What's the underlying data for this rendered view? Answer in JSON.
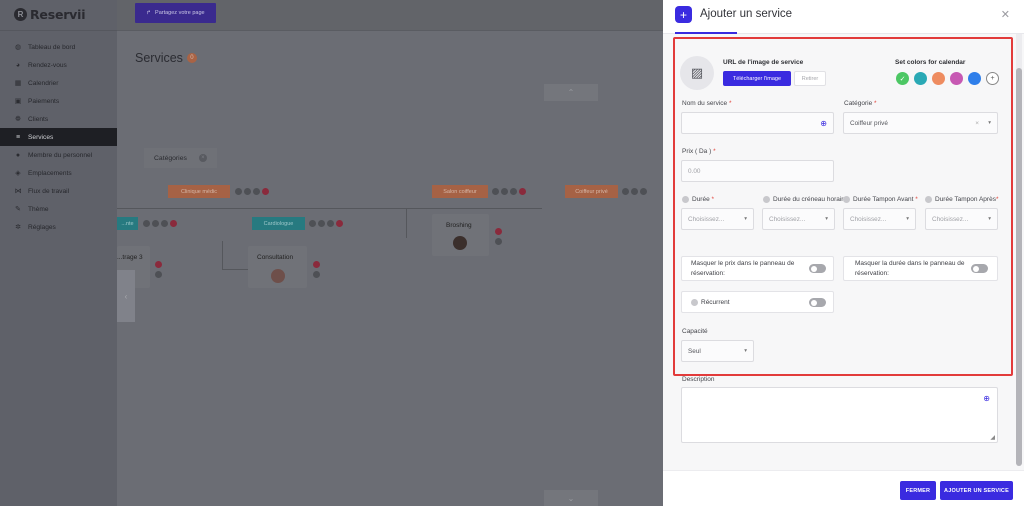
{
  "app": {
    "brand": "Reservii"
  },
  "sidebar": {
    "items": [
      {
        "label": "Tableau de bord",
        "icon": "dashboard-icon",
        "glyph": "◍"
      },
      {
        "label": "Rendez-vous",
        "icon": "calendar-check-icon",
        "glyph": "◕"
      },
      {
        "label": "Calendrier",
        "icon": "calendar-icon",
        "glyph": "▦"
      },
      {
        "label": "Paiements",
        "icon": "wallet-icon",
        "glyph": "▣"
      },
      {
        "label": "Clients",
        "icon": "users-icon",
        "glyph": "❁"
      },
      {
        "label": "Services",
        "icon": "services-icon",
        "glyph": "≡",
        "active": true
      },
      {
        "label": "Membre du personnel",
        "icon": "user-icon",
        "glyph": "●"
      },
      {
        "label": "Emplacements",
        "icon": "location-icon",
        "glyph": "◈"
      },
      {
        "label": "Flux de travail",
        "icon": "workflow-icon",
        "glyph": "⋈"
      },
      {
        "label": "Thème",
        "icon": "brush-icon",
        "glyph": "✎"
      },
      {
        "label": "Réglages",
        "icon": "gear-icon",
        "glyph": "✲"
      }
    ]
  },
  "topbar": {
    "share_label": "Partagez votre page"
  },
  "background": {
    "title": "Services",
    "count": "0",
    "categories_tab": "Catégories",
    "pills": {
      "clinique": "Clinique médic",
      "salon": "Salon coiffeur",
      "coiffeur_prive": "Coiffeur privé",
      "teal_left": "...nte",
      "cardiologue": "Cardiologue"
    },
    "cards": {
      "brushing": "Broshing",
      "consultation": "Consultation",
      "partial": "...trage 3"
    }
  },
  "modal": {
    "title": "Ajouter un service",
    "image_label": "URL de l'image de service",
    "upload_label": "Télécharger l'image",
    "remove_label": "Retirer",
    "colors_label": "Set colors for calendar",
    "colors": [
      "#4cc764",
      "#2aa9b5",
      "#ee8c60",
      "#c759b3",
      "#2f7fea"
    ],
    "service_name_label": "Nom du service",
    "service_name_value": "",
    "category_label": "Catégorie",
    "category_value": "Coiffeur privé",
    "price_label": "Prix ( Da )",
    "price_placeholder": "0.00",
    "duration_label": "Durée",
    "slot_label": "Durée du créneau horaire",
    "buffer_before_label": "Durée Tampon Avant",
    "buffer_after_label": "Durée Tampon Après",
    "choose_placeholder": "Choisissez...",
    "hide_price_label": "Masquer le prix dans le panneau de réservation:",
    "hide_duration_label": "Masquer la durée dans le panneau de réservation:",
    "recurring_label": "Récurrent",
    "capacity_label": "Capacité",
    "capacity_value": "Seul",
    "description_label": "Description",
    "close_button": "FERMER",
    "add_button": "AJOUTER UN SERVICE"
  }
}
